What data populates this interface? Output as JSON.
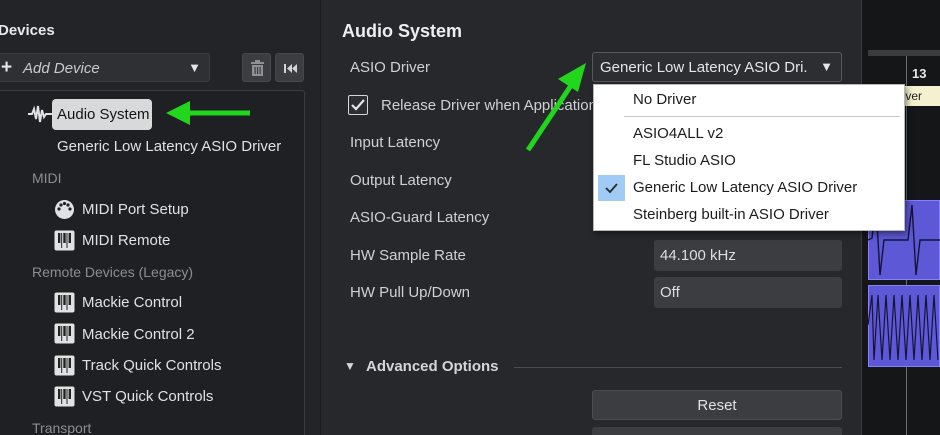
{
  "devices_panel": {
    "title": "Devices",
    "add_device": {
      "label": "Add Device",
      "arrow": "▼"
    },
    "tree": {
      "audio_system": "Audio System",
      "audio_driver_child": "Generic Low Latency ASIO Driver",
      "categories": {
        "midi": "MIDI",
        "remote_legacy": "Remote Devices (Legacy)",
        "transport": "Transport"
      },
      "midi_items": [
        "MIDI Port Setup",
        "MIDI Remote"
      ],
      "remote_items": [
        "Mackie Control",
        "Mackie Control 2",
        "Track Quick Controls",
        "VST Quick Controls"
      ]
    }
  },
  "audio_system_panel": {
    "title": "Audio System",
    "asio_driver": {
      "label": "ASIO Driver",
      "selected_display": "Generic Low Latency ASIO Dri.",
      "arrow": "▼"
    },
    "release_driver": {
      "label": "Release Driver when Application",
      "checked": true
    },
    "rows": {
      "input_latency": "Input Latency",
      "output_latency": "Output Latency",
      "asio_guard_latency": "ASIO-Guard Latency",
      "hw_sample_rate": "HW Sample Rate",
      "hw_pull": "HW Pull Up/Down"
    },
    "values": {
      "hw_sample_rate": "44.100 kHz",
      "hw_pull": "Off"
    },
    "advanced": {
      "toggle": "▼",
      "label": "Advanced Options"
    },
    "reset_button": "Reset"
  },
  "driver_menu": {
    "items": [
      "No Driver",
      "ASIO4ALL v2",
      "FL Studio ASIO",
      "Generic Low Latency ASIO Driver",
      "Steinberg built-in ASIO Driver"
    ],
    "selected": "Generic Low Latency ASIO Driver"
  },
  "background_project": {
    "ruler_number": "13",
    "tooltip": "Iver"
  },
  "colors": {
    "annotation_arrow": "#22d61e",
    "selection_highlight": "#9fcbf5",
    "clip_fill": "#5c58d6"
  }
}
